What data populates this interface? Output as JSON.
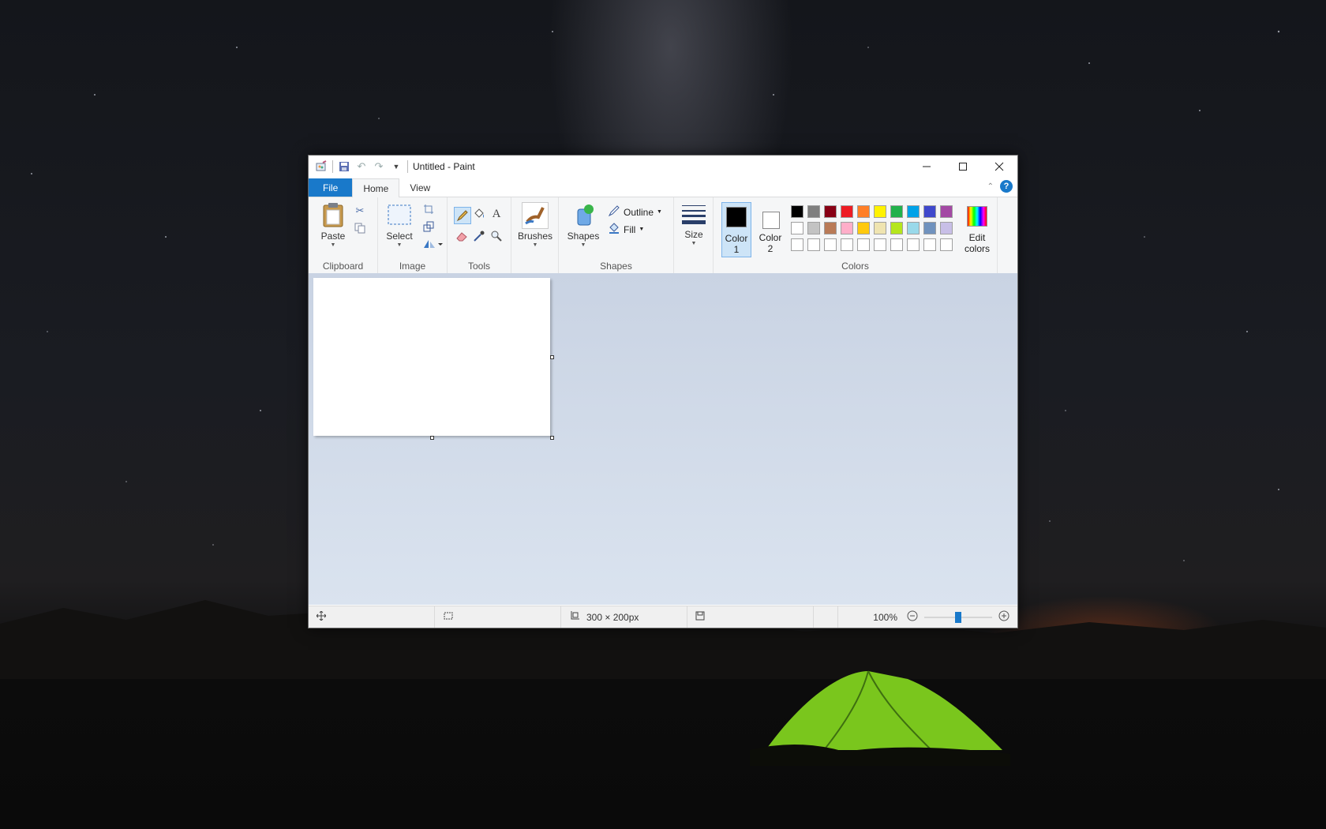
{
  "window": {
    "title": "Untitled - Paint"
  },
  "qat": {
    "icons": [
      "paint-app-icon",
      "save-icon",
      "undo-icon",
      "redo-icon",
      "customize-dropdown-icon"
    ]
  },
  "tabs": {
    "file": "File",
    "home": "Home",
    "view": "View"
  },
  "ribbon": {
    "clipboard": {
      "paste": "Paste",
      "group": "Clipboard"
    },
    "image": {
      "select": "Select",
      "group": "Image"
    },
    "tools": {
      "group": "Tools"
    },
    "brushes": {
      "label": "Brushes"
    },
    "shapes": {
      "label": "Shapes",
      "outline": "Outline",
      "fill": "Fill",
      "group": "Shapes"
    },
    "size": {
      "label": "Size"
    },
    "colors": {
      "color1_a": "Color",
      "color1_b": "1",
      "color2_a": "Color",
      "color2_b": "2",
      "edit_a": "Edit",
      "edit_b": "colors",
      "group": "Colors",
      "color1": "#000000",
      "color2": "#ffffff",
      "palette_row1": [
        "#000000",
        "#7f7f7f",
        "#880015",
        "#ed1c24",
        "#ff7f27",
        "#fff200",
        "#22b14c",
        "#00a2e8",
        "#3f48cc",
        "#a349a4"
      ],
      "palette_row2": [
        "#ffffff",
        "#c3c3c3",
        "#b97a57",
        "#ffaec9",
        "#ffc90e",
        "#efe4b0",
        "#b5e61d",
        "#99d9ea",
        "#7092be",
        "#c8bfe7"
      ],
      "palette_row3": [
        "#ffffff",
        "#ffffff",
        "#ffffff",
        "#ffffff",
        "#ffffff",
        "#ffffff",
        "#ffffff",
        "#ffffff",
        "#ffffff",
        "#ffffff"
      ]
    }
  },
  "status": {
    "dimensions": "300 × 200px",
    "zoom": "100%",
    "zoom_level": 0.5
  }
}
